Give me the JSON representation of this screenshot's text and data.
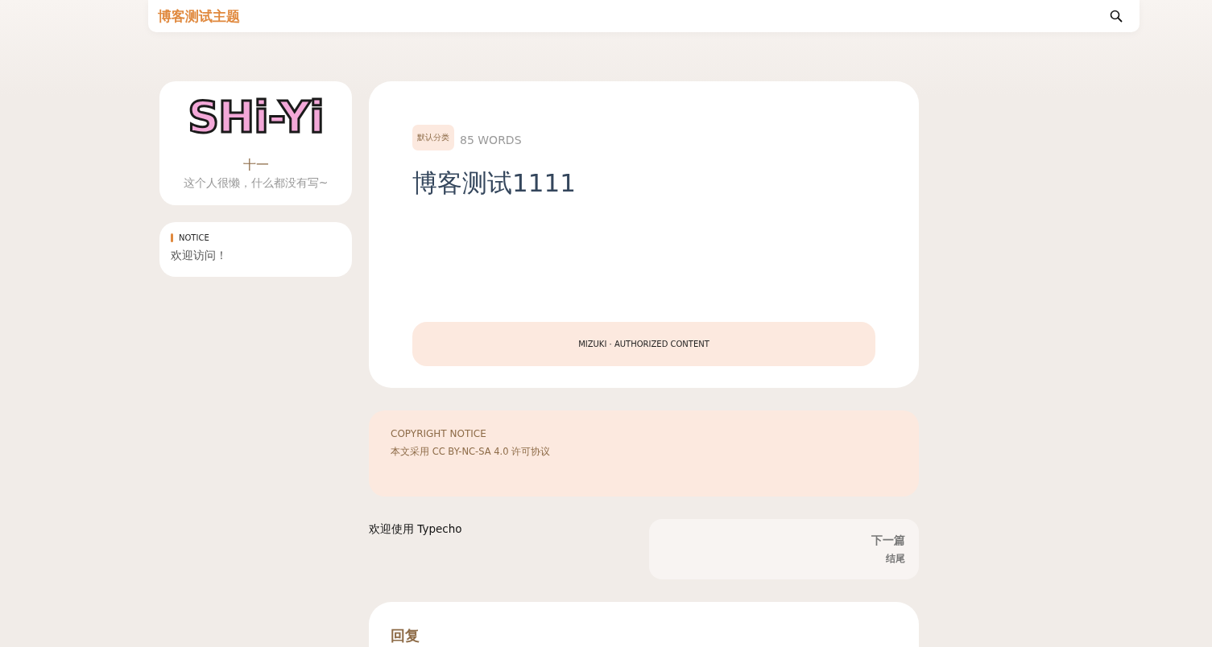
{
  "header": {
    "site_title": "博客测试主题"
  },
  "profile": {
    "logo_text": "SHi-Yi",
    "name": "十一",
    "bio": "这个人很懒，什么都没有写~"
  },
  "notice": {
    "title": "NOTICE",
    "text": "欢迎访问！"
  },
  "post": {
    "category": "默认分类",
    "word_count": "85 WORDS",
    "title": "博客测试1111",
    "banner": "MIZUKI · AUTHORIZED CONTENT"
  },
  "copyright": {
    "title": "COPYRIGHT NOTICE",
    "text": "本文采用 CC BY-NC-SA 4.0 许可协议"
  },
  "nav": {
    "prev_title": "欢迎使用 Typecho",
    "next_label": "下一篇",
    "next_title": "结尾"
  },
  "reply": {
    "title": "回复"
  }
}
